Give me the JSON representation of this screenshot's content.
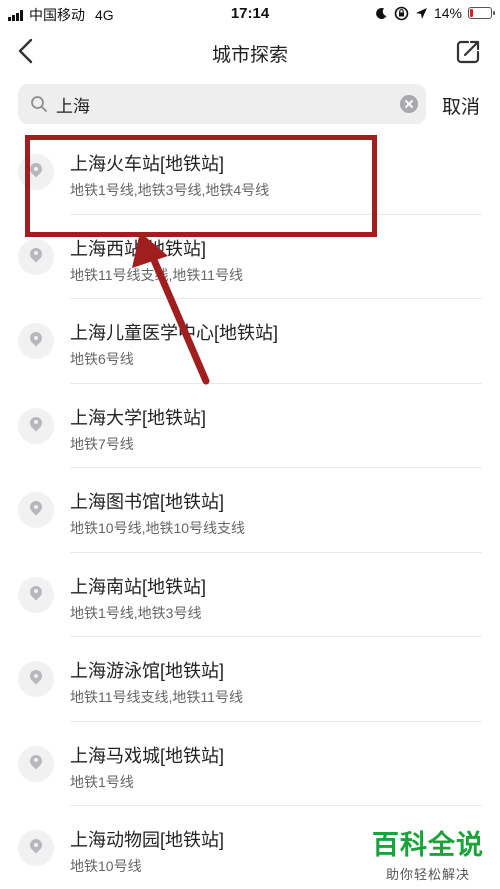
{
  "status_bar": {
    "carrier": "中国移动",
    "network": "4G",
    "time": "17:14",
    "battery_percent": "14%",
    "battery_level": 0.14,
    "battery_color": "#e02020"
  },
  "nav": {
    "title": "城市探索",
    "back_icon": "chevron-left-icon",
    "share_icon": "share-icon"
  },
  "search": {
    "value": "上海",
    "cancel_label": "取消"
  },
  "results": [
    {
      "name": "上海火车站[地铁站]",
      "lines": "地铁1号线,地铁3号线,地铁4号线"
    },
    {
      "name": "上海西站[地铁站]",
      "lines": "地铁11号线支线,地铁11号线"
    },
    {
      "name": "上海儿童医学中心[地铁站]",
      "lines": "地铁6号线"
    },
    {
      "name": "上海大学[地铁站]",
      "lines": "地铁7号线"
    },
    {
      "name": "上海图书馆[地铁站]",
      "lines": "地铁10号线,地铁10号线支线"
    },
    {
      "name": "上海南站[地铁站]",
      "lines": "地铁1号线,地铁3号线"
    },
    {
      "name": "上海游泳馆[地铁站]",
      "lines": "地铁11号线支线,地铁11号线"
    },
    {
      "name": "上海马戏城[地铁站]",
      "lines": "地铁1号线"
    },
    {
      "name": "上海动物园[地铁站]",
      "lines": "地铁10号线"
    }
  ],
  "annotation": {
    "color": "#a11e1e"
  },
  "watermark": {
    "title": "百科全说",
    "subtitle": "助你轻松解决",
    "color": "#1aa33a"
  }
}
